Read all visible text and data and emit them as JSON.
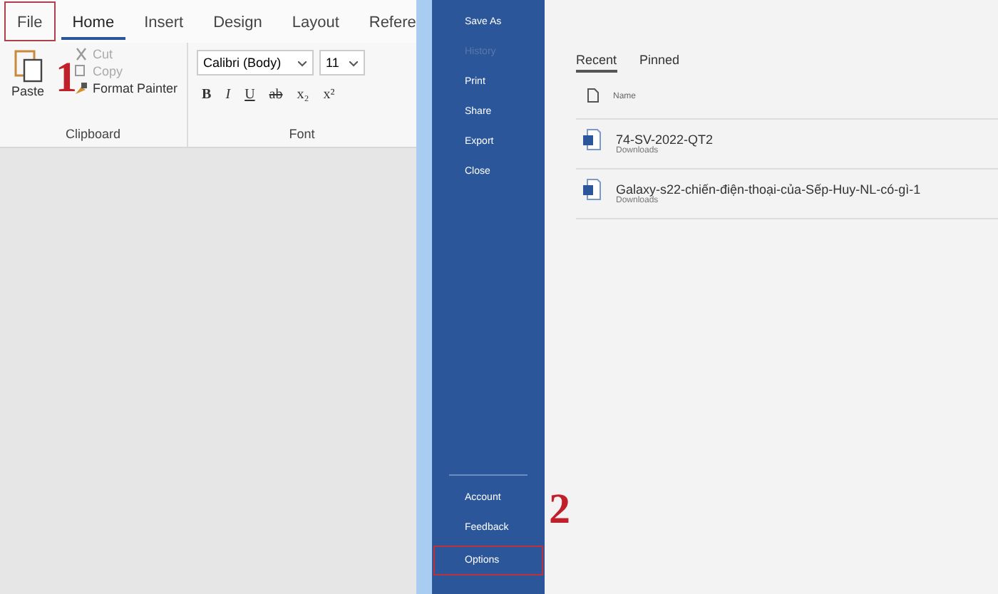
{
  "ribbon": {
    "tabs": [
      {
        "label": "File",
        "selected": false,
        "marked": true
      },
      {
        "label": "Home",
        "selected": true,
        "marked": false
      },
      {
        "label": "Insert",
        "selected": false,
        "marked": false
      },
      {
        "label": "Design",
        "selected": false,
        "marked": false
      },
      {
        "label": "Layout",
        "selected": false,
        "marked": false
      },
      {
        "label": "Refere",
        "selected": false,
        "marked": false
      }
    ],
    "clipboard": {
      "paste": "Paste",
      "items": [
        {
          "label": "Cut",
          "kind": "cut",
          "disabled": true
        },
        {
          "label": "Copy",
          "kind": "copy",
          "disabled": true
        },
        {
          "label": "Format Painter",
          "kind": "painter",
          "disabled": false
        }
      ],
      "label": "Clipboard"
    },
    "font": {
      "font_name": "Calibri (Body)",
      "font_size": "11",
      "buttons": [
        "B",
        "I",
        "U",
        "ab",
        "x₂",
        "x²"
      ],
      "label": "Font"
    }
  },
  "backstage": {
    "items": [
      {
        "label": "Save As",
        "disabled": false,
        "marked": false
      },
      {
        "label": "History",
        "disabled": true,
        "marked": false
      },
      {
        "label": "Print",
        "disabled": false,
        "marked": false
      },
      {
        "label": "Share",
        "disabled": false,
        "marked": false
      },
      {
        "label": "Export",
        "disabled": false,
        "marked": false
      },
      {
        "label": "Close",
        "disabled": false,
        "marked": false
      }
    ],
    "bottom_items": [
      {
        "label": "Account",
        "disabled": false,
        "marked": false
      },
      {
        "label": "Feedback",
        "disabled": false,
        "marked": false
      },
      {
        "label": "Options",
        "disabled": false,
        "marked": true
      }
    ]
  },
  "recent": {
    "tabs": [
      {
        "label": "Recent",
        "selected": true
      },
      {
        "label": "Pinned",
        "selected": false
      }
    ],
    "column": "Name",
    "files": [
      {
        "name": "74-SV-2022-QT2",
        "location": "Downloads"
      },
      {
        "name": "Galaxy-s22-chiến-điện-thoại-của-Sếp-Huy-NL-có-gì-1",
        "location": "Downloads"
      }
    ]
  },
  "annotations": [
    {
      "text": "1"
    },
    {
      "text": "2"
    }
  ]
}
